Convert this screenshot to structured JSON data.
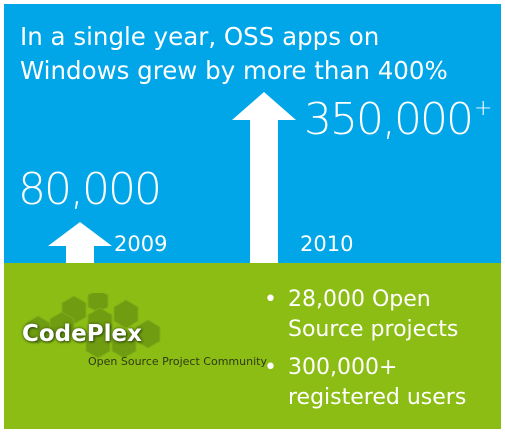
{
  "headline": "In a single year, OSS apps on Windows grew by more than 400%",
  "stats": [
    {
      "number": "80,000",
      "suffix": "",
      "year": "2009"
    },
    {
      "number": "350,000",
      "suffix": "+",
      "year": "2010"
    }
  ],
  "codeplex": {
    "logo_name": "CodePlex",
    "logo_tagline": "Open Source Project Community",
    "bullets": [
      "28,000 Open Source projects",
      "300,000+ registered users"
    ]
  },
  "colors": {
    "top_panel": "#00a6e8",
    "bottom_panel": "#8cbd14",
    "hexagon": "#6f9c10"
  },
  "icons": [
    "up-arrow-icon",
    "hexagon-logo-icon",
    "bullet-dot-icon"
  ]
}
